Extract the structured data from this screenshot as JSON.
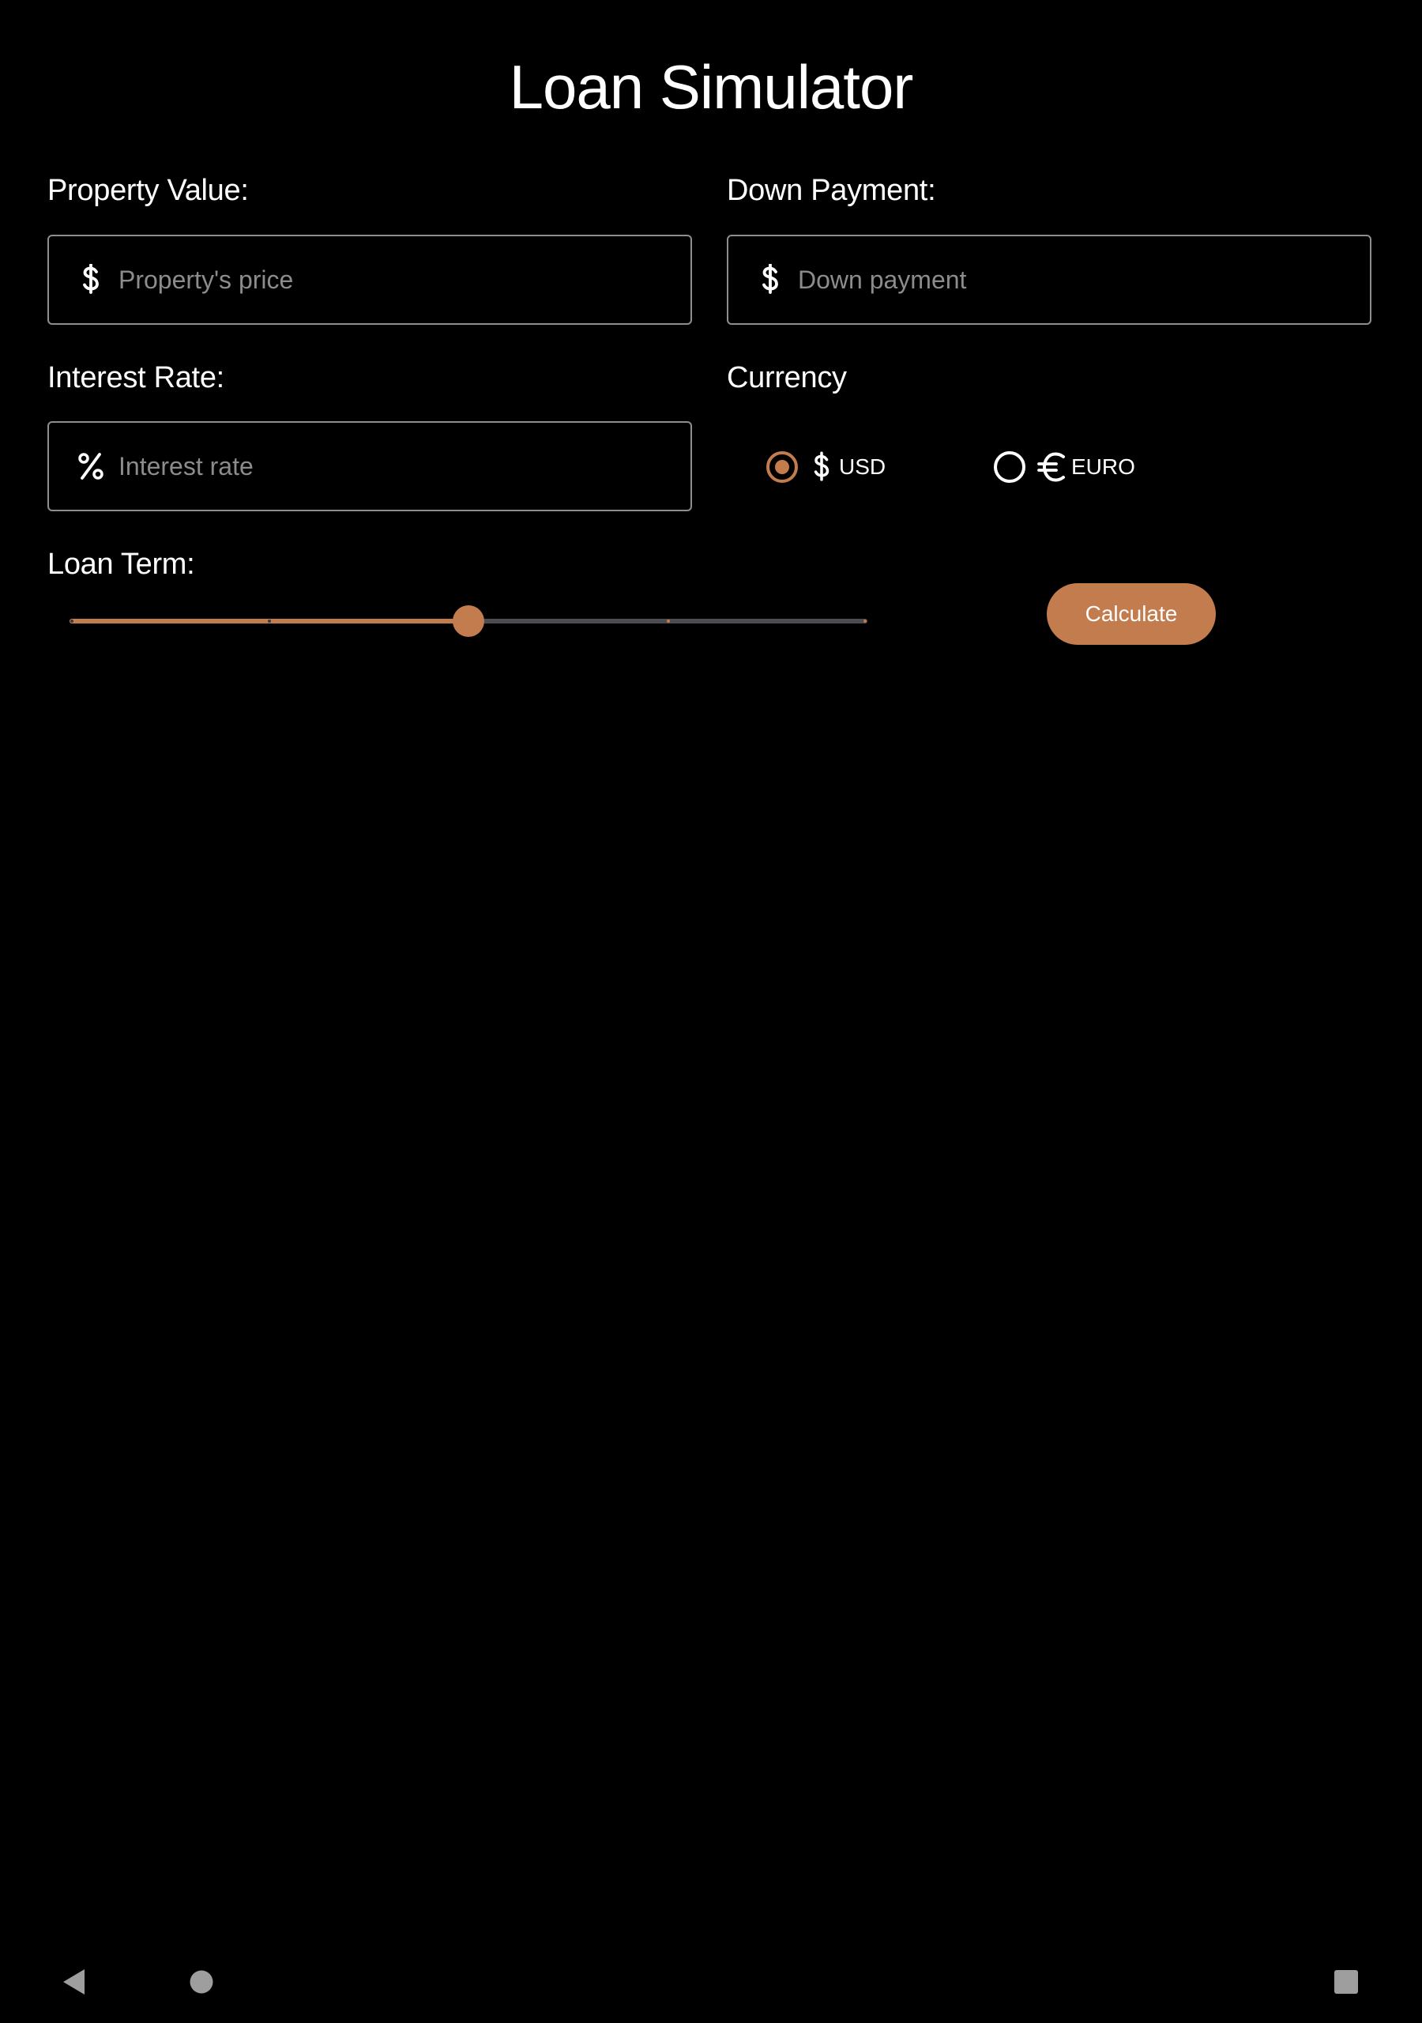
{
  "app": {
    "title": "Loan Simulator"
  },
  "form": {
    "property_value": {
      "label": "Property Value:",
      "placeholder": "Property's price",
      "value": "",
      "icon": "dollar-icon"
    },
    "down_payment": {
      "label": "Down Payment:",
      "placeholder": "Down payment",
      "value": "",
      "icon": "dollar-icon"
    },
    "interest_rate": {
      "label": "Interest Rate:",
      "placeholder": "Interest rate",
      "value": "",
      "icon": "percent-icon"
    },
    "currency": {
      "label": "Currency",
      "options": [
        {
          "label": "USD",
          "icon": "dollar-icon",
          "selected": true
        },
        {
          "label": "EURO",
          "icon": "euro-icon",
          "selected": false
        }
      ]
    },
    "loan_term": {
      "label": "Loan Term:",
      "steps": 5,
      "selected_index": 2
    },
    "calculate_label": "Calculate"
  },
  "nav": {
    "back_icon": "back-icon",
    "home_icon": "home-icon",
    "recents_icon": "recents-icon"
  },
  "colors": {
    "accent": "#c27c4e",
    "background": "#000000",
    "track_inactive": "#4d4c52",
    "field_border": "#8e8e8e",
    "placeholder": "#8c8c8c",
    "nav_icon": "#9e9e9e"
  }
}
